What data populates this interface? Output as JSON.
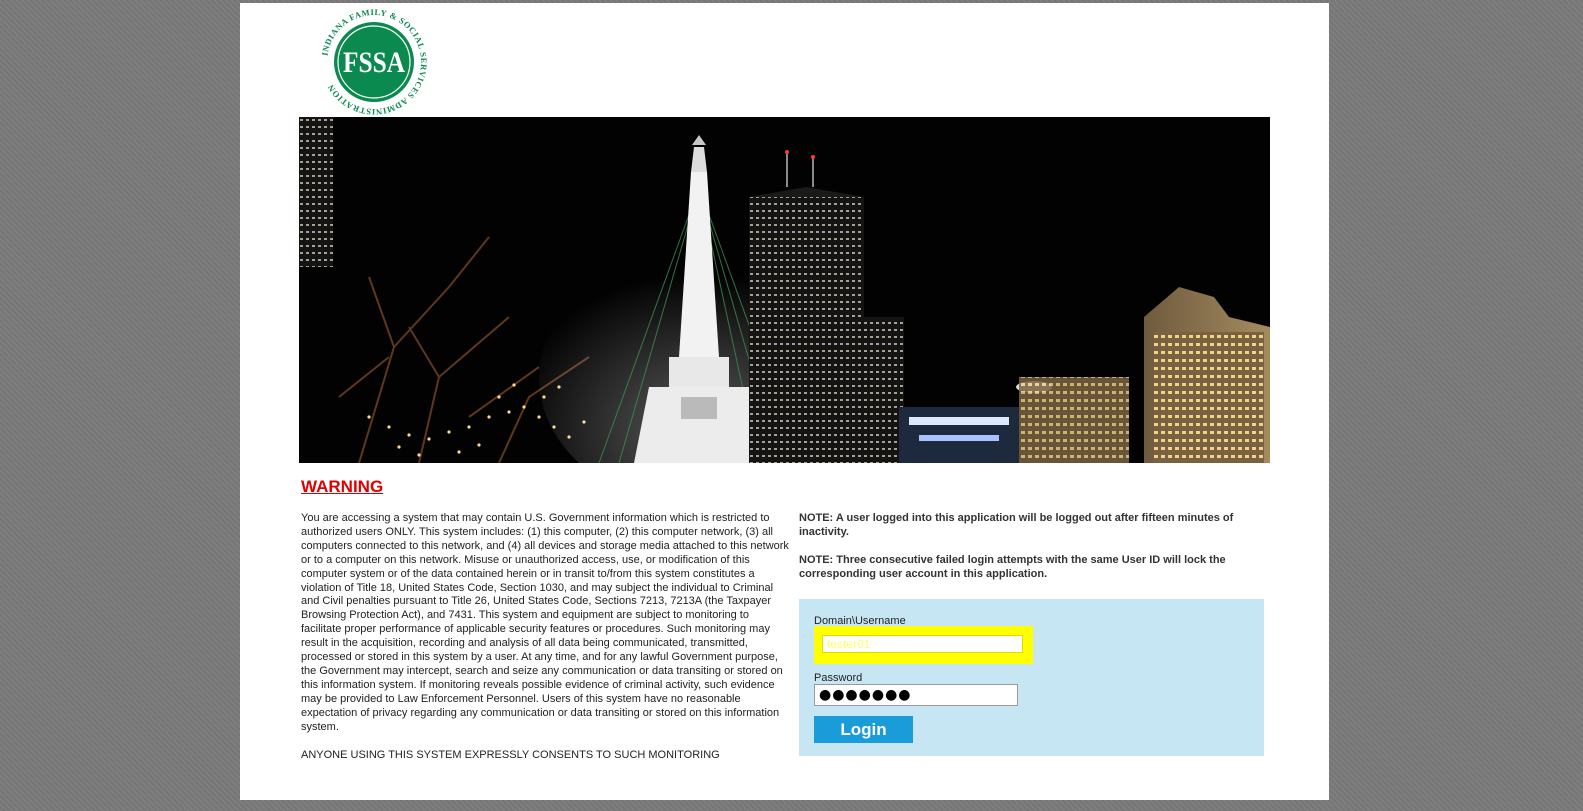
{
  "logo": {
    "monogram": "FSSA",
    "ring_text": "INDIANA FAMILY & SOCIAL SERVICES ADMINISTRATION",
    "color": "#0b8a4f"
  },
  "hero": {
    "icon": "indianapolis-monument-night-photo"
  },
  "warning": {
    "title": "WARNING",
    "body": "You are accessing a system that may contain U.S. Government information which is restricted to authorized users ONLY. This system includes: (1) this computer, (2) this computer network, (3) all computers connected to this network, and (4) all devices and storage media attached to this network or to a computer on this network. Misuse or unauthorized access, use, or modification of this computer system or of the data contained herein or in transit to/from this system constitutes a violation of Title 18, United States Code, Section 1030, and may subject the individual to Criminal and Civil penalties pursuant to Title 26, United States Code, Sections 7213, 7213A (the Taxpayer Browsing Protection Act), and 7431. This system and equipment are subject to monitoring to facilitate proper performance of applicable security features or procedures. Such monitoring may result in the acquisition, recording and analysis of all data being communicated, transmitted, processed or stored in this system by a user. At any time, and for any lawful Government purpose, the Government may intercept, search and seize any communication or data transiting or stored on this information system. If monitoring reveals possible evidence of criminal activity, such evidence may be provided to Law Enforcement Personnel. Users of this system have no reasonable expectation of privacy regarding any communication or data transiting or stored on this information system.",
    "consent": "ANYONE USING THIS SYSTEM EXPRESSLY CONSENTS TO SUCH MONITORING"
  },
  "notes": {
    "timeout": "NOTE: A user logged into this application will be logged out after fifteen minutes of inactivity.",
    "lockout": "NOTE: Three consecutive failed login attempts with the same User ID will lock the corresponding user account in this application."
  },
  "login": {
    "username_label": "Domain\\Username",
    "username_value": "tester01",
    "password_label": "Password",
    "password_masked": "●●●●●●●",
    "button_label": "Login"
  }
}
